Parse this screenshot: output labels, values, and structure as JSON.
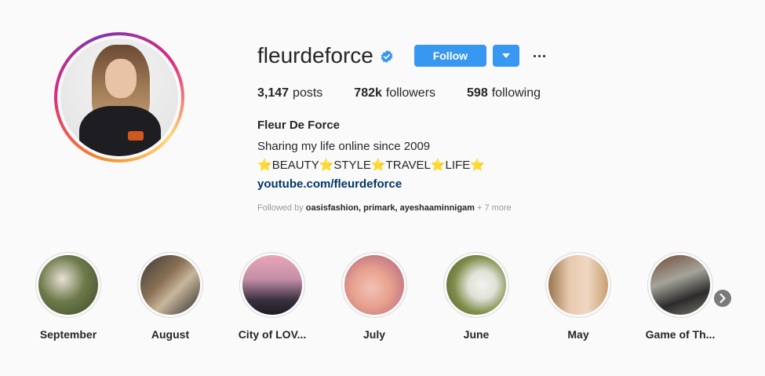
{
  "profile": {
    "username": "fleurdeforce",
    "verified_icon": "verified-badge-icon",
    "follow_label": "Follow",
    "dropdown_icon": "caret-down-icon",
    "more_icon": "more-options-icon",
    "accent_color": "#3897f0",
    "verified_color": "#3897f0"
  },
  "stats": {
    "posts_count": "3,147",
    "posts_label": "posts",
    "followers_count": "782k",
    "followers_label": "followers",
    "following_count": "598",
    "following_label": "following"
  },
  "bio": {
    "full_name": "Fleur De Force",
    "line1": "Sharing my life online since 2009",
    "tags": [
      "BEAUTY",
      "STYLE",
      "TRAVEL",
      "LIFE"
    ],
    "star_icon": "star-icon",
    "link": "youtube.com/fleurdeforce"
  },
  "followed_by": {
    "prefix": "Followed by",
    "users": "oasisfashion, primark, ayeshaaminnigam",
    "more": "+ 7 more"
  },
  "highlights": [
    {
      "label": "September"
    },
    {
      "label": "August"
    },
    {
      "label": "City of LOV..."
    },
    {
      "label": "July"
    },
    {
      "label": "June"
    },
    {
      "label": "May"
    },
    {
      "label": "Game of Th..."
    }
  ],
  "highlights_next_icon": "chevron-right-icon"
}
